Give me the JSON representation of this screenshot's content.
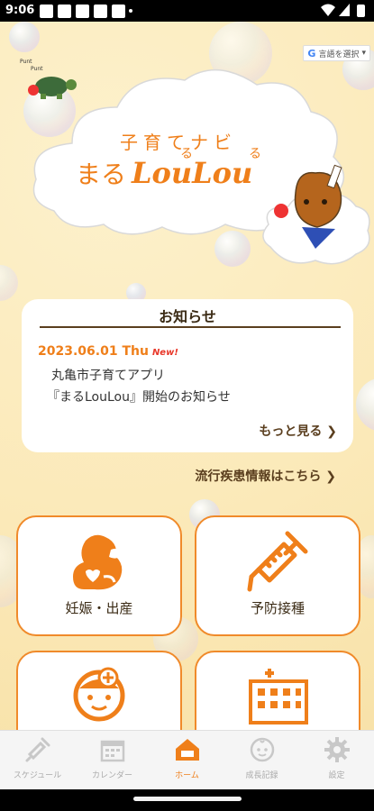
{
  "status_bar": {
    "time": "9:06"
  },
  "translate": {
    "label": "言語を選択"
  },
  "logo": {
    "subtitle": "子育てナビ",
    "maru": "まる",
    "brand": "LouLou",
    "ruby_1": "る",
    "ruby_2": "る"
  },
  "notice": {
    "title": "お知らせ",
    "date": "2023.06.01 Thu",
    "new_badge": "New!",
    "line1": "丸亀市子育てアプリ",
    "line2": "『まるLouLou』開始のお知らせ",
    "more": "もっと見る ❯"
  },
  "disease_link": "流行疾患情報はこちら ❯",
  "tiles": [
    {
      "label": "妊娠・出産",
      "icon": "pregnancy-icon"
    },
    {
      "label": "予防接種",
      "icon": "syringe-icon"
    },
    {
      "label": "",
      "icon": "child-face-icon"
    },
    {
      "label": "",
      "icon": "hospital-icon"
    }
  ],
  "bottom_nav": [
    {
      "label": "スケジュール",
      "icon": "syringe-icon",
      "active": false
    },
    {
      "label": "カレンダー",
      "icon": "calendar-icon",
      "active": false
    },
    {
      "label": "ホーム",
      "icon": "home-icon",
      "active": true
    },
    {
      "label": "成長記録",
      "icon": "baby-face-icon",
      "active": false
    },
    {
      "label": "設定",
      "icon": "gear-icon",
      "active": false
    }
  ],
  "colors": {
    "accent": "#ef7f1a",
    "background": "#fbe9b8",
    "text_brown": "#5a3e1e"
  }
}
